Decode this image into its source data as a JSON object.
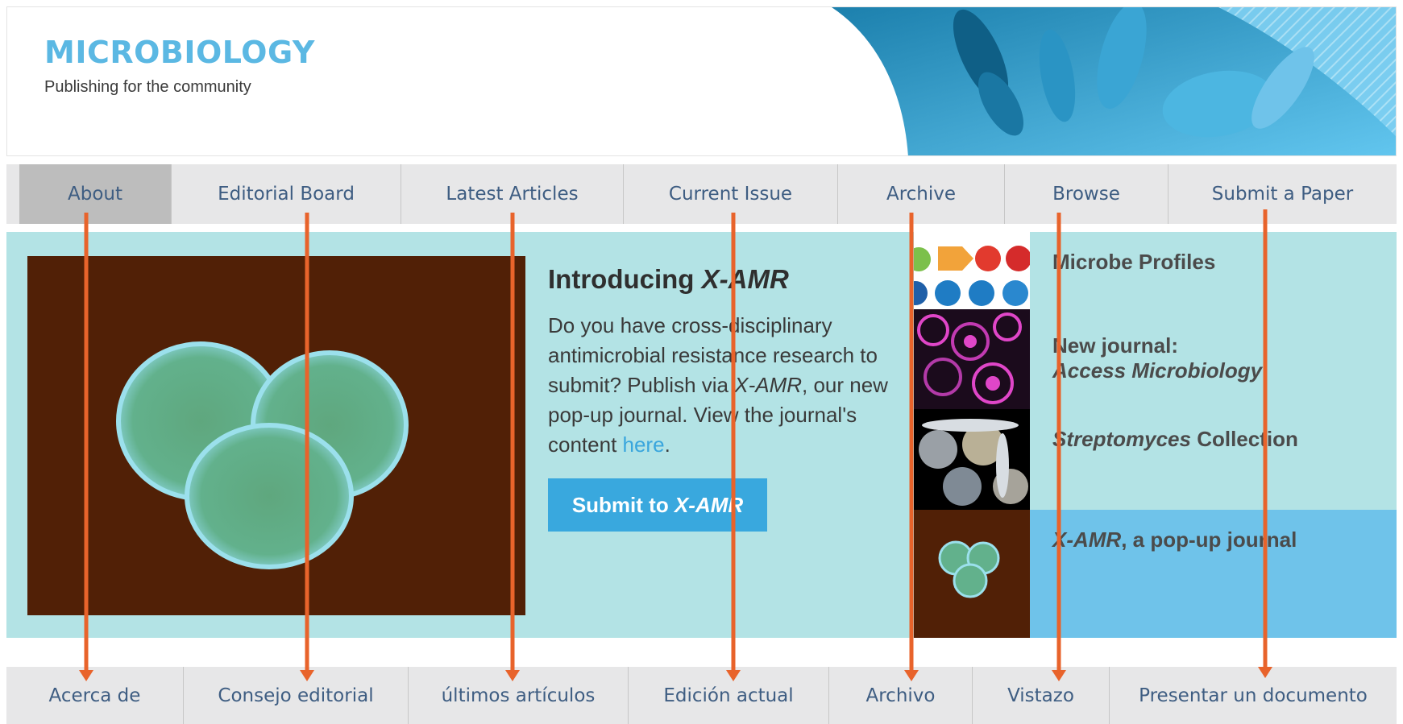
{
  "header": {
    "title": "MICROBIOLOGY",
    "tagline": "Publishing for the community"
  },
  "top_nav": [
    {
      "label": "About",
      "active": true
    },
    {
      "label": "Editorial Board",
      "active": false
    },
    {
      "label": "Latest Articles",
      "active": false
    },
    {
      "label": "Current Issue",
      "active": false
    },
    {
      "label": "Archive",
      "active": false
    },
    {
      "label": "Browse",
      "active": false
    },
    {
      "label": "Submit a Paper",
      "active": false
    }
  ],
  "intro": {
    "title_prefix": "Introducing ",
    "title_em": "X-AMR",
    "body_1": "Do you have cross-disciplinary antimicrobial resistance research to submit? Publish via ",
    "body_em": "X-AMR",
    "body_2": ", our new pop-up journal. View the journal's content ",
    "link": "here",
    "body_3": ".",
    "button_prefix": "Submit to ",
    "button_em": "X-AMR"
  },
  "features": [
    {
      "label": "Microbe Profiles"
    },
    {
      "label_1": "New journal:",
      "label_em": "Access Microbiology"
    },
    {
      "label_em": "Streptomyces",
      "label_rest": " Collection"
    },
    {
      "label_em": "X-AMR",
      "label_rest": ", a pop-up journal"
    }
  ],
  "bottom_nav": [
    {
      "label": "Acerca de"
    },
    {
      "label": "Consejo editorial"
    },
    {
      "label": "últimos artículos"
    },
    {
      "label": "Edición actual"
    },
    {
      "label": "Archivo"
    },
    {
      "label": "Vistazo"
    },
    {
      "label": "Presentar un documento"
    }
  ],
  "colors": {
    "brand": "#5bb8e3",
    "nav_text": "#3e5d82",
    "band": "#b3e3e5",
    "button": "#39a8de",
    "highlight": "#6fc3ea",
    "arrow": "#e8632b"
  }
}
